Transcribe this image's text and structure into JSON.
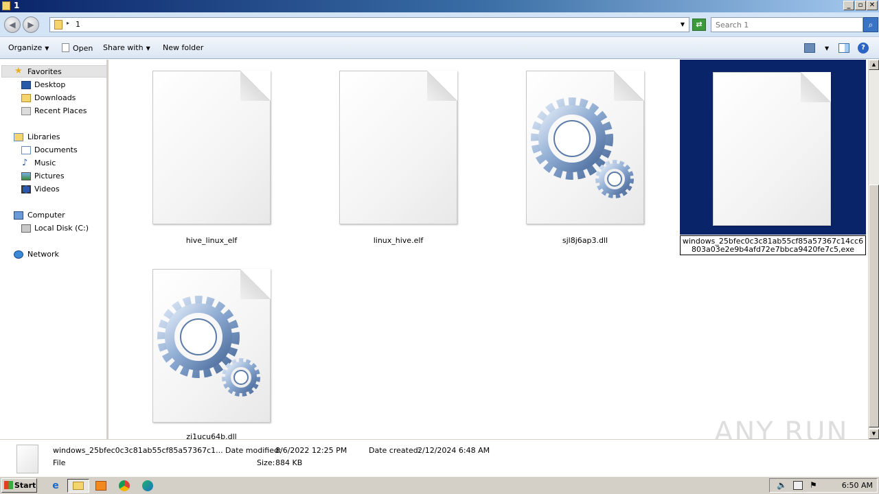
{
  "window": {
    "title": "1",
    "min_glyph": "_",
    "max_glyph": "▫",
    "close_glyph": "✕"
  },
  "address_bar": {
    "back_glyph": "◀",
    "forward_glyph": "▶",
    "path": "1",
    "search_placeholder": "Search 1"
  },
  "command_bar": {
    "organize": "Organize",
    "open": "Open",
    "share_with": "Share with",
    "new_folder": "New folder"
  },
  "nav": {
    "favorites": "Favorites",
    "desktop": "Desktop",
    "downloads": "Downloads",
    "recent_places": "Recent Places",
    "libraries": "Libraries",
    "documents": "Documents",
    "music": "Music",
    "pictures": "Pictures",
    "videos": "Videos",
    "computer": "Computer",
    "local_disk": "Local Disk (C:)",
    "network": "Network"
  },
  "files": [
    {
      "name": "hive_linux_elf",
      "icon": "blank-document-icon"
    },
    {
      "name": "linux_hive.elf",
      "icon": "blank-document-icon"
    },
    {
      "name": "sjl8j6ap3.dll",
      "icon": "dll-gears-icon"
    },
    {
      "name": "windows_25bfec0c3c81ab55cf85a57367c14cc6803a03e2e9b4afd72e7bbca9420fe7c5,exe",
      "icon": "blank-document-icon",
      "selected": true
    },
    {
      "name": "zi1ucu64b.dll",
      "icon": "dll-gears-icon"
    }
  ],
  "details": {
    "name": "windows_25bfec0c3c81ab55cf85a57367c1...",
    "type": "File",
    "date_modified_label": "Date modified:",
    "date_modified": "8/6/2022 12:25 PM",
    "size_label": "Size:",
    "size": "884 KB",
    "date_created_label": "Date created:",
    "date_created": "2/12/2024 6:48 AM"
  },
  "taskbar": {
    "start": "Start",
    "clock": "6:50 AM"
  },
  "watermark": "ANY RUN",
  "colors": {
    "selection": "#0a246a",
    "titlebar": "#0a246a",
    "taskbar": "#d4d0c8"
  }
}
